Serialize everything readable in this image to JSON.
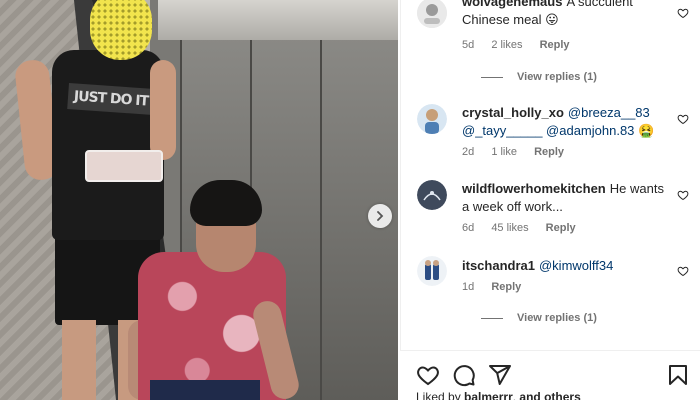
{
  "post": {
    "image_alt_people": [
      "person-in-just-do-it-tank",
      "person-in-pink-tshirt"
    ],
    "shirt_text": "JUST DO IT",
    "next_icon": "chevron-right-icon"
  },
  "comments": [
    {
      "username": "wolvagenemaus",
      "text": "A succulent Chinese meal",
      "emoji": "😛",
      "age": "5d",
      "likes": "2 likes",
      "reply_label": "Reply",
      "view_replies": "View replies (1)"
    },
    {
      "username": "crystal_holly_xo",
      "mentions": [
        "@breeza__83",
        "@_tayy_____",
        "@adamjohn.83"
      ],
      "emoji": "🤮",
      "age": "2d",
      "likes": "1 like",
      "reply_label": "Reply"
    },
    {
      "username": "wildflowerhomekitchen",
      "text": "He wants a week off work...",
      "age": "6d",
      "likes": "45 likes",
      "reply_label": "Reply"
    },
    {
      "username": "itschandra1",
      "mention": "@kimwolff34",
      "age": "1d",
      "reply_label": "Reply",
      "view_replies": "View replies (1)"
    }
  ],
  "actions": {
    "like_icon": "heart-icon",
    "comment_icon": "comment-icon",
    "share_icon": "share-icon",
    "save_icon": "bookmark-icon"
  },
  "liked_by": {
    "prefix": "Liked by",
    "user": "balmerrr",
    "suffix": "and others"
  },
  "colors": {
    "text": "#262626",
    "muted": "#737373",
    "mention": "#00376b"
  }
}
